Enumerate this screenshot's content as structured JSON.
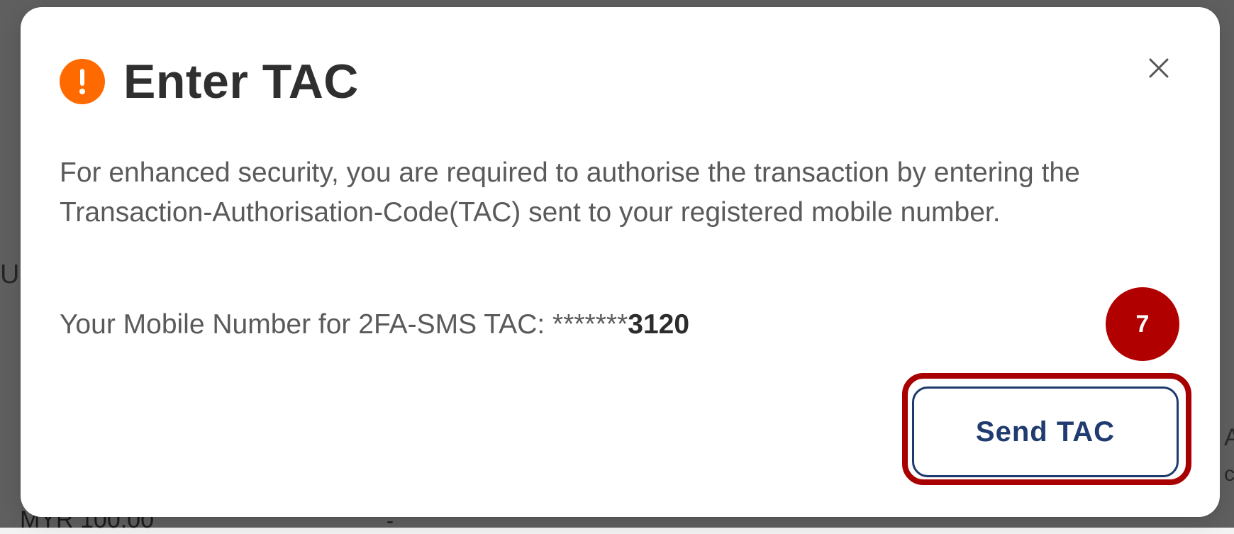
{
  "background": {
    "partial_left_text": "U",
    "partial_bottom_amount": "MYR 100.00",
    "partial_bottom_dash": "-",
    "partial_right_a": "A",
    "partial_right_c": "c"
  },
  "modal": {
    "title": "Enter TAC",
    "description": "For enhanced security, you are required to authorise the transaction by entering the Transaction-Authorisation-Code(TAC) sent to your registered mobile number.",
    "mobile_prefix": "Your Mobile Number for 2FA-SMS TAC: *******",
    "mobile_suffix": "3120",
    "step_badge": "7",
    "send_button": "Send TAC"
  },
  "icons": {
    "warning": "warning-icon",
    "close": "close-icon"
  },
  "colors": {
    "warning_orange": "#ff6a00",
    "step_red": "#b10000",
    "button_blue": "#1f3b6f",
    "text_gray": "#5a5a5a"
  }
}
